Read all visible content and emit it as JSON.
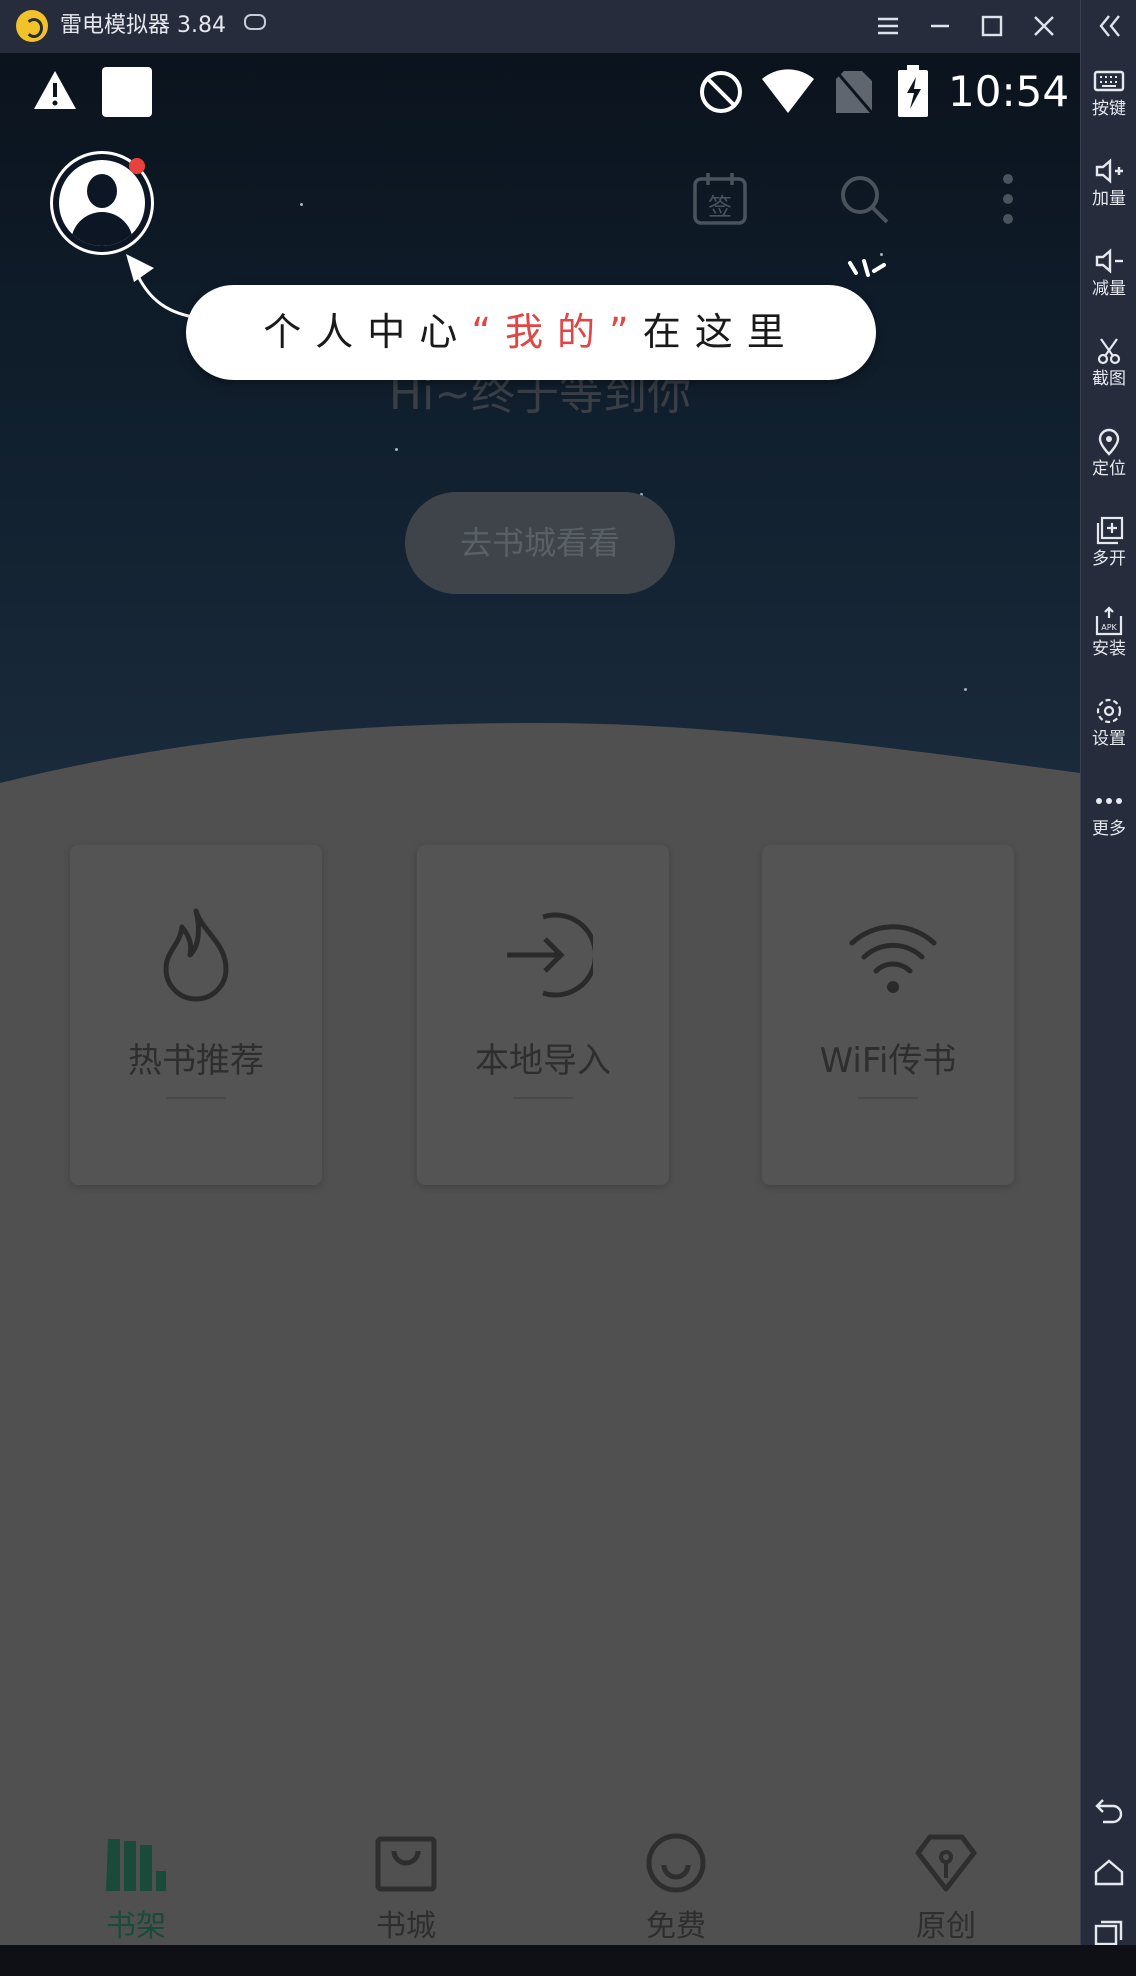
{
  "window": {
    "title": "雷电模拟器 3.84",
    "icons": [
      "emulator-logo-icon",
      "gamepad-icon",
      "menu-icon",
      "minimize-icon",
      "maximize-icon",
      "close-icon",
      "collapse-icon"
    ]
  },
  "sidebar": {
    "items": [
      {
        "label": "按键",
        "icon": "keyboard-icon"
      },
      {
        "label": "加量",
        "icon": "volume-up-icon"
      },
      {
        "label": "减量",
        "icon": "volume-down-icon"
      },
      {
        "label": "截图",
        "icon": "scissors-icon"
      },
      {
        "label": "定位",
        "icon": "location-icon"
      },
      {
        "label": "多开",
        "icon": "multi-open-icon"
      },
      {
        "label": "安装",
        "icon": "apk-install-icon"
      },
      {
        "label": "设置",
        "icon": "settings-icon"
      },
      {
        "label": "更多",
        "icon": "more-dots-icon"
      }
    ],
    "nav_icons": [
      "back-icon",
      "home-icon",
      "recents-icon"
    ]
  },
  "statusbar": {
    "time": "10:54",
    "icons": [
      "warning-icon",
      "notification-square-icon",
      "do-not-disturb-icon",
      "wifi-icon",
      "no-sim-icon",
      "battery-charging-icon"
    ]
  },
  "header": {
    "sign_label": "签"
  },
  "tooltip": {
    "prefix": "个人中心",
    "highlight": "“我的”",
    "suffix": "在这里"
  },
  "main": {
    "greeting": "Hi~终于等到你",
    "store_button": "去书城看看"
  },
  "cards": [
    {
      "label": "热书推荐",
      "icon": "flame-icon"
    },
    {
      "label": "本地导入",
      "icon": "import-arrow-icon"
    },
    {
      "label": "WiFi传书",
      "icon": "wifi-transfer-icon"
    }
  ],
  "bottom_nav": [
    {
      "label": "书架",
      "icon": "bookshelf-icon",
      "active": true
    },
    {
      "label": "书城",
      "icon": "shopping-bag-icon",
      "active": false
    },
    {
      "label": "免费",
      "icon": "smile-icon",
      "active": false
    },
    {
      "label": "原创",
      "icon": "pen-nib-icon",
      "active": false
    }
  ],
  "colors": {
    "accent_active": "#1a4a3a",
    "notification_dot": "#e8423f",
    "tooltip_highlight": "#e14545"
  }
}
